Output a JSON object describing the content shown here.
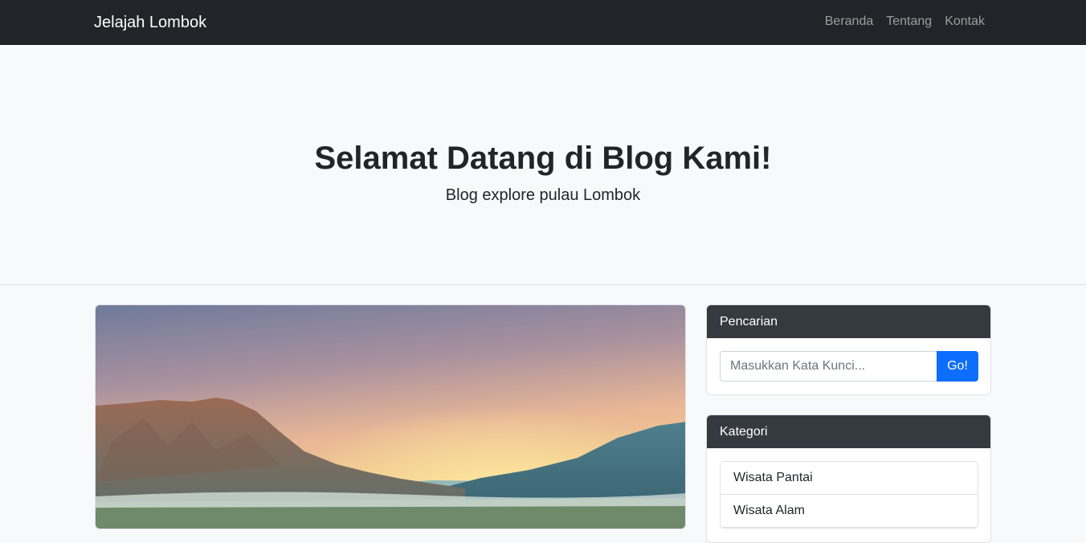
{
  "navbar": {
    "brand": "Jelajah Lombok",
    "links": [
      {
        "label": "Beranda"
      },
      {
        "label": "Tentang"
      },
      {
        "label": "Kontak"
      }
    ]
  },
  "hero": {
    "title": "Selamat Datang di Blog Kami!",
    "subtitle": "Blog explore pulau Lombok"
  },
  "search": {
    "header": "Pencarian",
    "placeholder": "Masukkan Kata Kunci...",
    "value": "",
    "button_label": "Go!"
  },
  "categories": {
    "header": "Kategori",
    "items": [
      {
        "label": "Wisata Pantai"
      },
      {
        "label": "Wisata Alam"
      }
    ]
  },
  "colors": {
    "navbar_bg": "#212529",
    "card_header_bg": "#343a40",
    "button_primary": "#0d6efd",
    "page_bg": "#f8f9fa"
  }
}
